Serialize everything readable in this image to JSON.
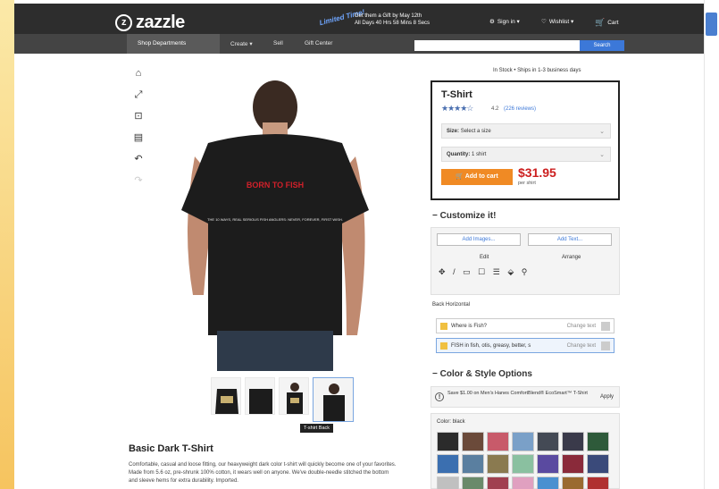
{
  "header": {
    "logo_text": "zazzle",
    "promo_badge": "Limited Time!",
    "promo_line1": "Get them a Gift by May 12th",
    "promo_line2": "All Days 40 Hrs 58 Mins 8 Secs",
    "sign_in": "Sign in ▾",
    "wishlist": "Wishlist ▾",
    "cart": "Cart"
  },
  "nav": {
    "shop": "Shop Departments",
    "create": "Create ▾",
    "sell": "Sell",
    "gift": "Gift Center",
    "search_placeholder": "",
    "search_button": "Search"
  },
  "tools": [
    "home-icon",
    "expand-icon",
    "fit-icon",
    "template-icon",
    "undo-icon",
    "redo-icon"
  ],
  "shirt": {
    "back_title": "BORN TO FISH",
    "back_text": "THE 10 WAYS, REAL SERIOUS FISH ANGLERS: NEVER, FOREVER, FIRST WISH."
  },
  "thumbnails_label": "T-shirt Back",
  "description": {
    "title": "Basic Dark T-Shirt",
    "text": "Comfortable, casual and loose fitting, our heavyweight dark color t-shirt will quickly become one of your favorites. Made from 5.6 oz, pre-shrunk 100% cotton, it wears well on anyone. We've double-needle stitched the bottom and sleeve hems for extra durability. Imported."
  },
  "product": {
    "stock": "In Stock • Ships in 1-3 business days",
    "title": "T-Shirt",
    "stars": "★★★★☆",
    "rating": "4.2",
    "reviews": "(226 reviews)",
    "size_label": "Size:",
    "size_value": "Select a size",
    "qty_label": "Quantity:",
    "qty_value": "1 shirt",
    "add_to_cart": "Add to cart",
    "price": "$31.95",
    "per_unit": "per shirt"
  },
  "customize": {
    "heading": "− Customize it!",
    "add_images": "Add Images...",
    "add_text": "Add Text...",
    "edit": "Edit",
    "arrange": "Arrange",
    "side": "Back Horizontal",
    "layers": [
      {
        "label": "Where is Fish?",
        "action": "Change text"
      },
      {
        "label": "FISH in fish, otis, greasy, better, s",
        "action": "Change text"
      }
    ]
  },
  "color_style": {
    "heading": "− Color & Style Options",
    "promo": "Save $1.00 on Men's Hanes ComfortBlend® EcoSmart™ T-Shirt",
    "apply": "Apply",
    "color_label": "Color: black",
    "swatches": [
      "#2b2b2b",
      "#6b4a3a",
      "#c85a6a",
      "#7aa0c8",
      "#444a55",
      "#3a3a4a",
      "#2e5a3a",
      "#3b6fb0",
      "#5a7fa0",
      "#8a7a50",
      "#8ac0a0",
      "#5a4aa0",
      "#8a2a3a",
      "#3a4a7a",
      "#c0c0c0",
      "#6a8a6a",
      "#a04050",
      "#e0a0c0",
      "#4a90d0",
      "#9a6a30",
      "#b03030"
    ]
  }
}
